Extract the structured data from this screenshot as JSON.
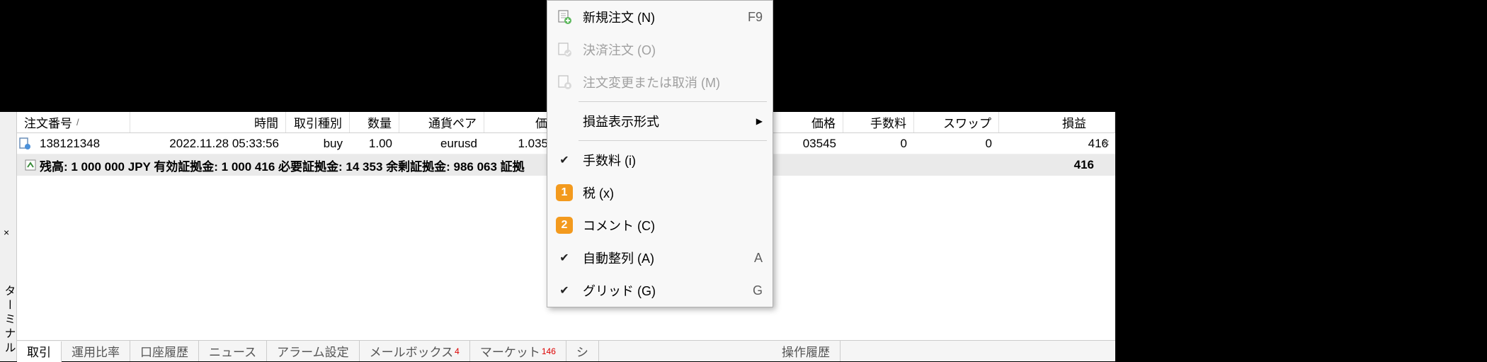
{
  "vertical_title": "ターミナル",
  "close_x": "×",
  "headers": {
    "order": "注文番号",
    "sort": "/",
    "time": "時間",
    "type": "取引種別",
    "vol": "数量",
    "symbol": "通貨ペア",
    "price1": "価",
    "price2": "価格",
    "fee": "手数料",
    "swap": "スワップ",
    "pl": "損益"
  },
  "row": {
    "order": "138121348",
    "time": "2022.11.28 05:33:56",
    "type": "buy",
    "vol": "1.00",
    "symbol": "eurusd",
    "price1": "1.035",
    "price2": "03545",
    "fee": "0",
    "swap": "0",
    "pl": "416",
    "close": "×"
  },
  "summary": {
    "text": "残高: 1 000 000 JPY  有効証拠金: 1 000 416  必要証拠金: 14 353  余剰証拠金: 986 063  証拠",
    "pl": "416"
  },
  "tabs": {
    "t1": "取引",
    "t2": "運用比率",
    "t3": "口座履歴",
    "t4": "ニュース",
    "t5": "アラーム設定",
    "t6": "メールボックス",
    "t6_badge": "4",
    "t7": "マーケット",
    "t7_badge": "146",
    "t8": "シ",
    "t9": "操作履歴"
  },
  "menu": {
    "new_order": "新規注文 (N)",
    "new_order_sc": "F9",
    "close_order": "決済注文 (O)",
    "modify_order": "注文変更または取消 (M)",
    "pl_format": "損益表示形式",
    "fee": "手数料 (i)",
    "tax": "税 (x)",
    "comment": "コメント (C)",
    "auto_arrange": "自動整列 (A)",
    "auto_arrange_sc": "A",
    "grid": "グリッド (G)",
    "grid_sc": "G",
    "badge1": "1",
    "badge2": "2"
  }
}
